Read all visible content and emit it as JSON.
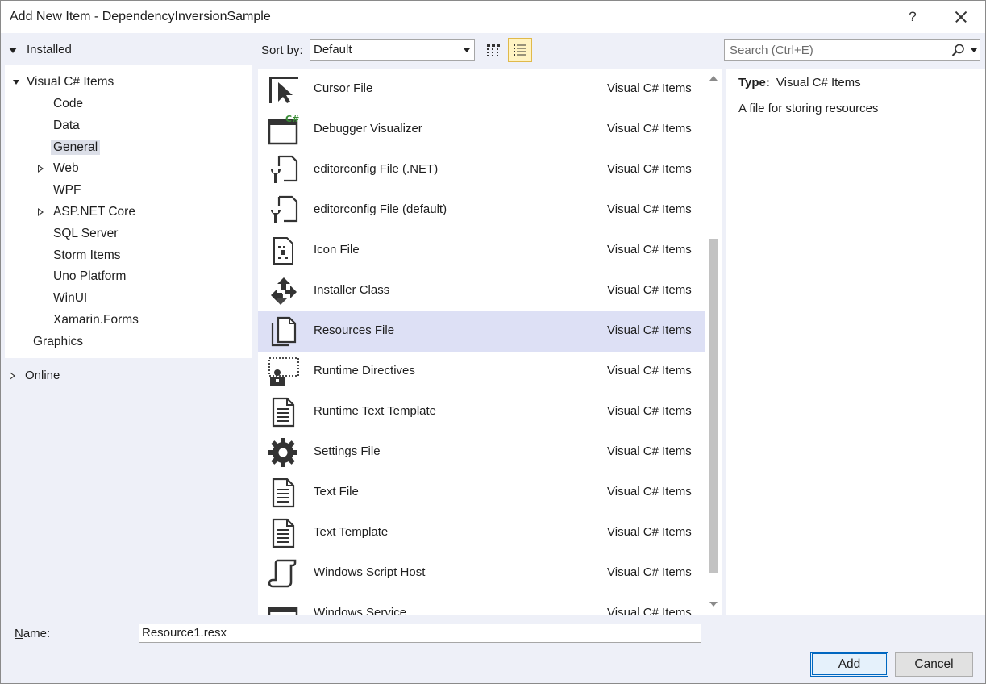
{
  "window": {
    "title": "Add New Item - DependencyInversionSample",
    "help_label": "?"
  },
  "left_panel": {
    "installed_label": "Installed",
    "tree": [
      {
        "label": "Visual C# Items",
        "expander": "expanded"
      },
      {
        "label": "Code"
      },
      {
        "label": "Data"
      },
      {
        "label": "General",
        "selected": true
      },
      {
        "label": "Web",
        "expander": "collapsed"
      },
      {
        "label": "WPF"
      },
      {
        "label": "ASP.NET Core",
        "expander": "collapsed"
      },
      {
        "label": "SQL Server"
      },
      {
        "label": "Storm Items"
      },
      {
        "label": "Uno Platform"
      },
      {
        "label": "WinUI"
      },
      {
        "label": "Xamarin.Forms"
      },
      {
        "label": "Graphics"
      }
    ],
    "online_label": "Online"
  },
  "toolbar": {
    "sort_by_label": "Sort by:",
    "sort_value": "Default",
    "view_modes": [
      "small-icons-view",
      "list-view"
    ],
    "active_view": "list-view"
  },
  "search": {
    "placeholder": "Search (Ctrl+E)"
  },
  "items": [
    {
      "name": "Cursor File",
      "category": "Visual C# Items",
      "icon": "cursor-file-icon"
    },
    {
      "name": "Debugger Visualizer",
      "category": "Visual C# Items",
      "icon": "debugger-visualizer-icon"
    },
    {
      "name": "editorconfig File (.NET)",
      "category": "Visual C# Items",
      "icon": "editorconfig-icon"
    },
    {
      "name": "editorconfig File (default)",
      "category": "Visual C# Items",
      "icon": "editorconfig-icon"
    },
    {
      "name": "Icon File",
      "category": "Visual C# Items",
      "icon": "icon-file-icon"
    },
    {
      "name": "Installer Class",
      "category": "Visual C# Items",
      "icon": "installer-class-icon"
    },
    {
      "name": "Resources File",
      "category": "Visual C# Items",
      "icon": "resources-file-icon",
      "selected": true
    },
    {
      "name": "Runtime Directives",
      "category": "Visual C# Items",
      "icon": "runtime-directives-icon"
    },
    {
      "name": "Runtime Text Template",
      "category": "Visual C# Items",
      "icon": "text-template-icon"
    },
    {
      "name": "Settings File",
      "category": "Visual C# Items",
      "icon": "settings-gear-icon"
    },
    {
      "name": "Text File",
      "category": "Visual C# Items",
      "icon": "text-file-icon"
    },
    {
      "name": "Text Template",
      "category": "Visual C# Items",
      "icon": "text-template-icon"
    },
    {
      "name": "Windows Script Host",
      "category": "Visual C# Items",
      "icon": "script-scroll-icon"
    },
    {
      "name": "Windows Service",
      "category": "Visual C# Items",
      "icon": "windows-service-icon"
    }
  ],
  "details": {
    "type_label": "Type:",
    "type_value": "Visual C# Items",
    "description": "A file for storing resources"
  },
  "bottom": {
    "name_label_mnemonic": "N",
    "name_label_rest": "ame:",
    "name_value": "Resource1.resx",
    "add_mnemonic": "A",
    "add_rest": "dd",
    "cancel_label": "Cancel"
  },
  "colors": {
    "window_bg": "#eef0f8",
    "selected_row": "#dde0f5",
    "active_view_bg": "#fff3c2",
    "primary_border": "#0067c0"
  }
}
